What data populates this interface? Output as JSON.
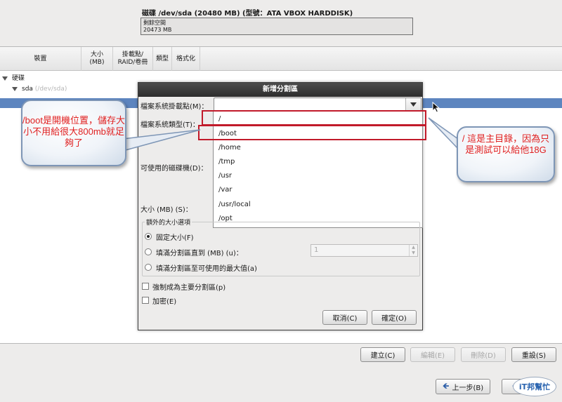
{
  "disk": {
    "title": "磁碟 /dev/sda (20480 MB) (型號：ATA VBOX HARDDISK)",
    "free_label": "剩餘空間",
    "free_size": "20473 MB"
  },
  "table": {
    "headers": [
      "裝置",
      "大小\n(MB)",
      "掛載點/\nRAID/卷冊",
      "類型",
      "格式化"
    ],
    "root_label": "硬碟",
    "disk_name": "sda",
    "disk_path": "(/dev/sda)"
  },
  "dialog": {
    "title": "新增分割區",
    "mount_label": "檔案系統掛載點(M)：",
    "fstype_label": "檔案系統類型(T)：",
    "drives_label": "可使用的磁碟機(D)：",
    "size_label": "大小 (MB) (S)：",
    "mount_options": [
      "/",
      "/boot",
      "/home",
      "/tmp",
      "/usr",
      "/var",
      "/usr/local",
      "/opt"
    ],
    "extra_legend": "額外的大小選項",
    "radio_fixed": "固定大小(F)",
    "radio_fill_upto": "填滿分割區直到 (MB) (u)：",
    "radio_fill_max": "填滿分割區至可使用的最大值(a)",
    "fill_value": "1",
    "check_primary": "強制成為主要分割區(p)",
    "check_encrypt": "加密(E)",
    "cancel_label": "取消(C)",
    "ok_label": "確定(O)"
  },
  "toolbar": {
    "create_label": "建立(C)",
    "edit_label": "編輯(E)",
    "delete_label": "刪除(D)",
    "reset_label": "重設(S)"
  },
  "nav": {
    "back_label": "上一步(B)"
  },
  "callouts": {
    "left": "/boot是開機位置，儲存大小不用給很大800mb就足夠了",
    "right": "/ 這是主目錄，因為只是測試可以給他18G"
  },
  "watermark": "iT邦幫忙",
  "colors": {
    "selection": "#5d85bf",
    "highlight": "#c11a2a",
    "callout_text": "#e02020"
  }
}
